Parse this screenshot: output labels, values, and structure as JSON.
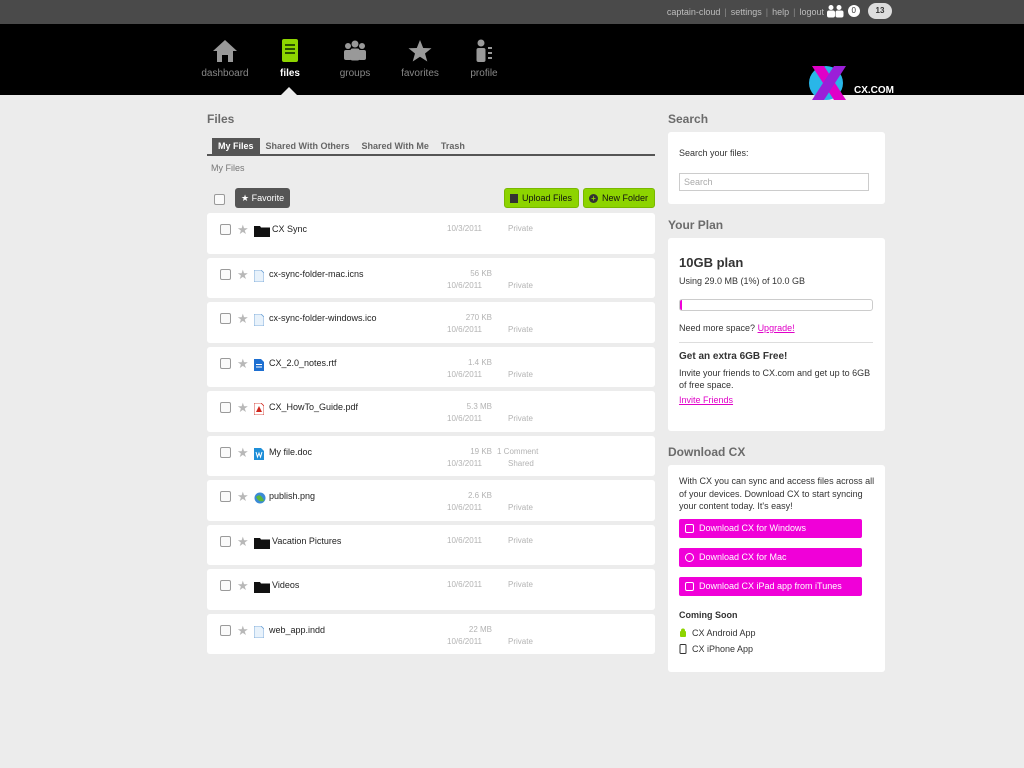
{
  "topbar": {
    "links": [
      "captain-cloud",
      "settings",
      "help",
      "logout"
    ],
    "people_icon": "people-icon",
    "people_count": "0",
    "cloud_count": "13"
  },
  "nav": {
    "items": [
      {
        "label": "dashboard",
        "icon": "home-icon"
      },
      {
        "label": "files",
        "icon": "document-icon",
        "active": true
      },
      {
        "label": "groups",
        "icon": "groups-icon"
      },
      {
        "label": "favorites",
        "icon": "star-icon"
      },
      {
        "label": "profile",
        "icon": "profile-icon"
      }
    ],
    "logo_text": "CX.COM"
  },
  "files": {
    "title": "Files",
    "tabs": [
      "My Files",
      "Shared With Others",
      "Shared With Me",
      "Trash"
    ],
    "breadcrumb": "My Files",
    "favorite_button": "Favorite",
    "upload_button": "Upload Files",
    "new_folder_button": "New Folder",
    "rows": [
      {
        "name": "CX Sync",
        "type": "folder",
        "size": "",
        "date": "10/3/2011",
        "share": "Private",
        "comment": ""
      },
      {
        "name": "cx-sync-folder-mac.icns",
        "type": "file",
        "size": "56 KB",
        "date": "10/6/2011",
        "share": "Private",
        "comment": ""
      },
      {
        "name": "cx-sync-folder-windows.ico",
        "type": "file",
        "size": "270 KB",
        "date": "10/6/2011",
        "share": "Private",
        "comment": ""
      },
      {
        "name": "CX_2.0_notes.rtf",
        "type": "rtf",
        "size": "1.4 KB",
        "date": "10/6/2011",
        "share": "Private",
        "comment": ""
      },
      {
        "name": "CX_HowTo_Guide.pdf",
        "type": "pdf",
        "size": "5.3 MB",
        "date": "10/6/2011",
        "share": "Private",
        "comment": ""
      },
      {
        "name": "My file.doc",
        "type": "doc",
        "size": "19 KB",
        "date": "10/3/2011",
        "share": "Shared",
        "comment": "1 Comment"
      },
      {
        "name": "publish.png",
        "type": "image",
        "size": "2.6 KB",
        "date": "10/6/2011",
        "share": "Private",
        "comment": ""
      },
      {
        "name": "Vacation Pictures",
        "type": "folder",
        "size": "",
        "date": "10/6/2011",
        "share": "Private",
        "comment": ""
      },
      {
        "name": "Videos",
        "type": "folder",
        "size": "",
        "date": "10/6/2011",
        "share": "Private",
        "comment": ""
      },
      {
        "name": "web_app.indd",
        "type": "file",
        "size": "22 MB",
        "date": "10/6/2011",
        "share": "Private",
        "comment": ""
      }
    ]
  },
  "search": {
    "title": "Search",
    "label": "Search your files:",
    "placeholder": "Search"
  },
  "plan": {
    "title": "Your Plan",
    "name": "10GB plan",
    "usage": "Using 29.0 MB (1%) of 10.0 GB",
    "usage_fraction": 0.01,
    "need_more": "Need more space?",
    "upgrade": "Upgrade!",
    "extra_title": "Get an extra 6GB Free!",
    "extra_body": "Invite your friends to CX.com and get up to 6GB of free space.",
    "invite": "Invite Friends"
  },
  "download": {
    "title": "Download CX",
    "body": "With CX you can sync and access files across all of your devices. Download CX to start syncing your content today. It's easy!",
    "buttons": [
      "Download CX for Windows",
      "Download CX for Mac",
      "Download CX iPad app from iTunes"
    ],
    "coming_soon": "Coming Soon",
    "apps": [
      "CX Android App",
      "CX iPhone App"
    ]
  },
  "colors": {
    "accent_pink": "#f000d8",
    "accent_green": "#8dd400"
  }
}
